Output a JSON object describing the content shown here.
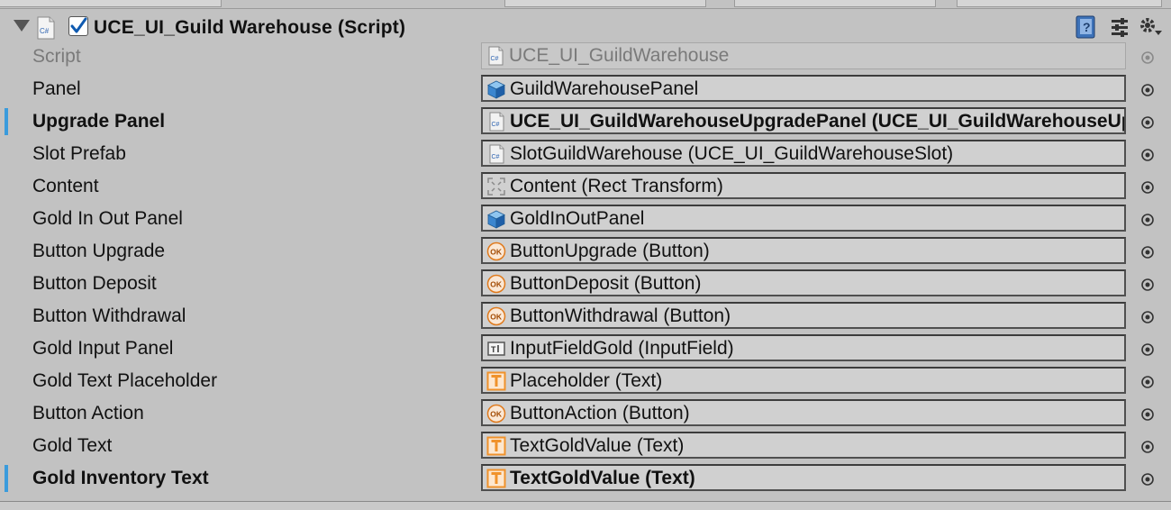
{
  "component": {
    "title": "UCE_UI_Guild Warehouse (Script)",
    "enabled": true
  },
  "icons": {
    "foldout": "foldout-triangle-down-icon",
    "script": "csharp-script-icon",
    "help": "help-book-icon",
    "presets": "presets-sliders-icon",
    "settings": "gear-menu-icon"
  },
  "colors": {
    "background": "#c2c2c2",
    "field_background": "#d0d0d0",
    "accent_override": "#3a9bdc",
    "disabled_text": "#7a7a7a",
    "text_icon_orange": "#f0922b"
  },
  "rows": [
    {
      "label": "Script",
      "value": "UCE_UI_GuildWarehouse",
      "icon": "cs",
      "bold": false,
      "disabled": true,
      "modified": false
    },
    {
      "label": "Panel",
      "value": "GuildWarehousePanel",
      "icon": "cube",
      "bold": false,
      "disabled": false,
      "modified": false
    },
    {
      "label": "Upgrade Panel",
      "value": "UCE_UI_GuildWarehouseUpgradePanel (UCE_UI_GuildWarehouseUpgradePanel)",
      "icon": "cs",
      "bold": true,
      "disabled": false,
      "modified": true
    },
    {
      "label": "Slot Prefab",
      "value": "SlotGuildWarehouse (UCE_UI_GuildWarehouseSlot)",
      "icon": "cs",
      "bold": false,
      "disabled": false,
      "modified": false
    },
    {
      "label": "Content",
      "value": "Content (Rect Transform)",
      "icon": "rect",
      "bold": false,
      "disabled": false,
      "modified": false
    },
    {
      "label": "Gold In Out Panel",
      "value": "GoldInOutPanel",
      "icon": "cube",
      "bold": false,
      "disabled": false,
      "modified": false
    },
    {
      "label": "Button Upgrade",
      "value": "ButtonUpgrade (Button)",
      "icon": "ok",
      "bold": false,
      "disabled": false,
      "modified": false
    },
    {
      "label": "Button Deposit",
      "value": "ButtonDeposit (Button)",
      "icon": "ok",
      "bold": false,
      "disabled": false,
      "modified": false
    },
    {
      "label": "Button Withdrawal",
      "value": "ButtonWithdrawal (Button)",
      "icon": "ok",
      "bold": false,
      "disabled": false,
      "modified": false
    },
    {
      "label": "Gold Input Panel",
      "value": "InputFieldGold (InputField)",
      "icon": "input",
      "bold": false,
      "disabled": false,
      "modified": false
    },
    {
      "label": "Gold Text Placeholder",
      "value": "Placeholder (Text)",
      "icon": "text",
      "bold": false,
      "disabled": false,
      "modified": false
    },
    {
      "label": "Button Action",
      "value": "ButtonAction (Button)",
      "icon": "ok",
      "bold": false,
      "disabled": false,
      "modified": false
    },
    {
      "label": "Gold Text",
      "value": "TextGoldValue (Text)",
      "icon": "text",
      "bold": false,
      "disabled": false,
      "modified": false
    },
    {
      "label": "Gold Inventory Text",
      "value": "TextGoldValue (Text)",
      "icon": "text",
      "bold": true,
      "disabled": false,
      "modified": true
    }
  ]
}
